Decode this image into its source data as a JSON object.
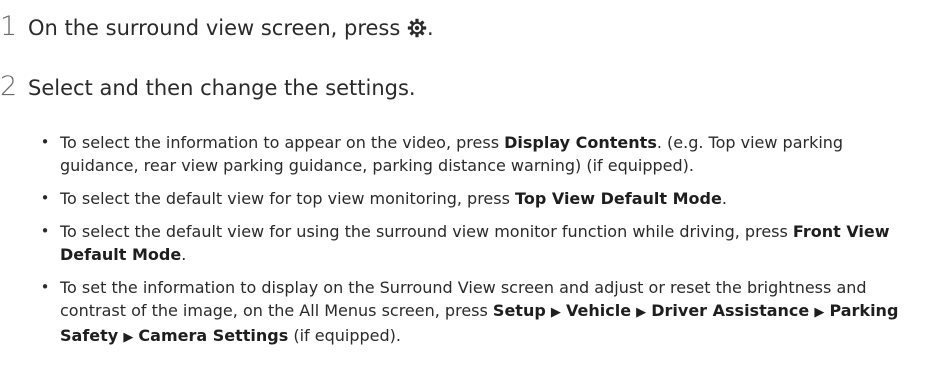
{
  "step1": {
    "number": "1",
    "text": "On the surround view screen, press ",
    "icon": "gear-icon",
    "suffix": "."
  },
  "step2": {
    "number": "2",
    "text": "Select and then change the settings."
  },
  "bullets": [
    {
      "pre": "To select the information to appear on the video, press ",
      "bold": "Display Contents",
      "post": ". (e.g. Top view parking guidance, rear view parking guidance, parking distance warning) (if equipped)."
    },
    {
      "pre": "To select the default view for top view monitoring, press ",
      "bold": "Top View Default Mode",
      "post": "."
    },
    {
      "pre": "To select the default view for using the surround view monitor function while driving, press ",
      "bold": "Front View Default Mode",
      "post": "."
    },
    {
      "pre": "To set the information to display on the Surround View screen and adjust or reset the brightness and contrast of the image, on the All Menus screen, press ",
      "path": [
        "Setup",
        "Vehicle",
        "Driver Assistance",
        "Parking Safety",
        "Camera Settings"
      ],
      "separator": "▶",
      "post": " (if equipped)."
    }
  ]
}
